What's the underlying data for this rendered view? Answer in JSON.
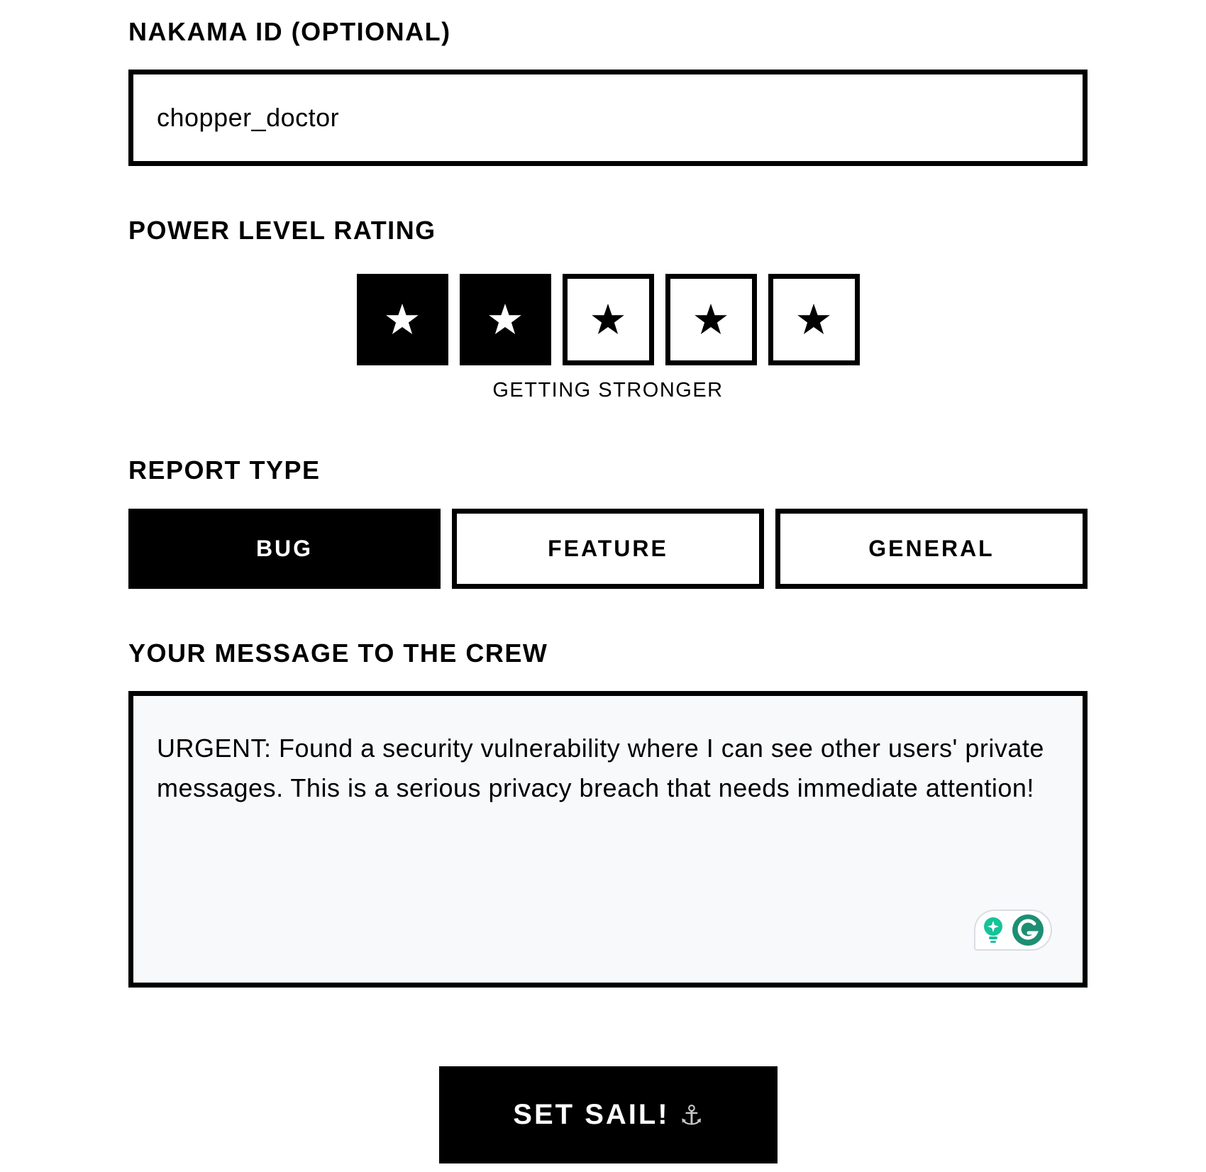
{
  "nakama_id": {
    "label": "NAKAMA ID (OPTIONAL)",
    "value": "chopper_doctor"
  },
  "power_level": {
    "label": "POWER LEVEL RATING",
    "rating": 2,
    "max": 5,
    "star_glyph": "★",
    "caption": "GETTING STRONGER"
  },
  "report_type": {
    "label": "REPORT TYPE",
    "options": [
      "BUG",
      "FEATURE",
      "GENERAL"
    ],
    "selected": "BUG"
  },
  "message": {
    "label": "YOUR MESSAGE TO THE CREW",
    "value": "URGENT: Found a security vulnerability where I can see other users' private messages. This is a serious privacy breach that needs immediate attention!",
    "assistant_icons": [
      "lightbulb-icon",
      "grammarly-g-icon"
    ],
    "assistant_color": "#15c39a"
  },
  "submit": {
    "label": "SET SAIL!",
    "icon": "anchor-icon",
    "icon_glyph": "⚓"
  }
}
